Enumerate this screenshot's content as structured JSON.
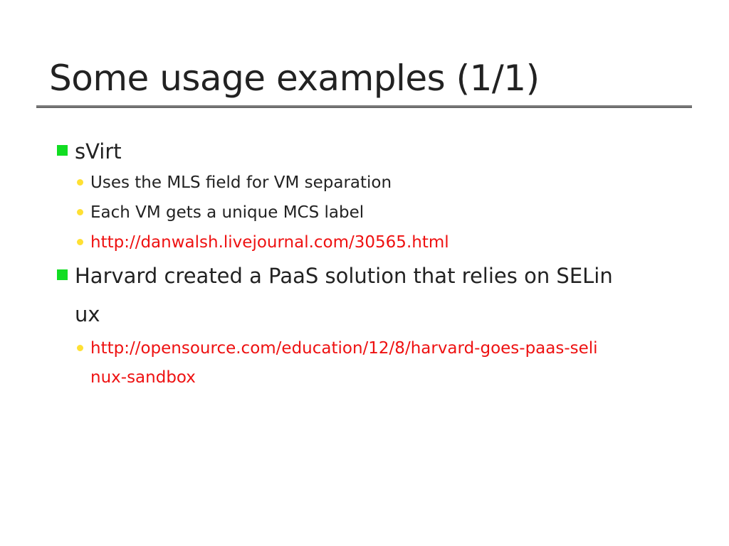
{
  "slide": {
    "title": "Some usage examples (1/1)",
    "items": [
      {
        "text": "sVirt",
        "subitems": [
          "Uses the MLS field for VM separation",
          "Each VM gets a unique MCS label",
          "http://danwalsh.livejournal.com/30565.html"
        ]
      },
      {
        "text_line1": "Harvard created a PaaS solution that relies on SELin",
        "text_line2": "ux",
        "subitems": [
          {
            "line1": "http://opensource.com/education/12/8/harvard-goes-paas-seli",
            "line2": "nux-sandbox"
          }
        ]
      }
    ],
    "colors": {
      "bullet_level1": "#11dd22",
      "bullet_level2": "#ffe033",
      "link": "#ee1111",
      "rule": "#6b6b6b"
    }
  }
}
